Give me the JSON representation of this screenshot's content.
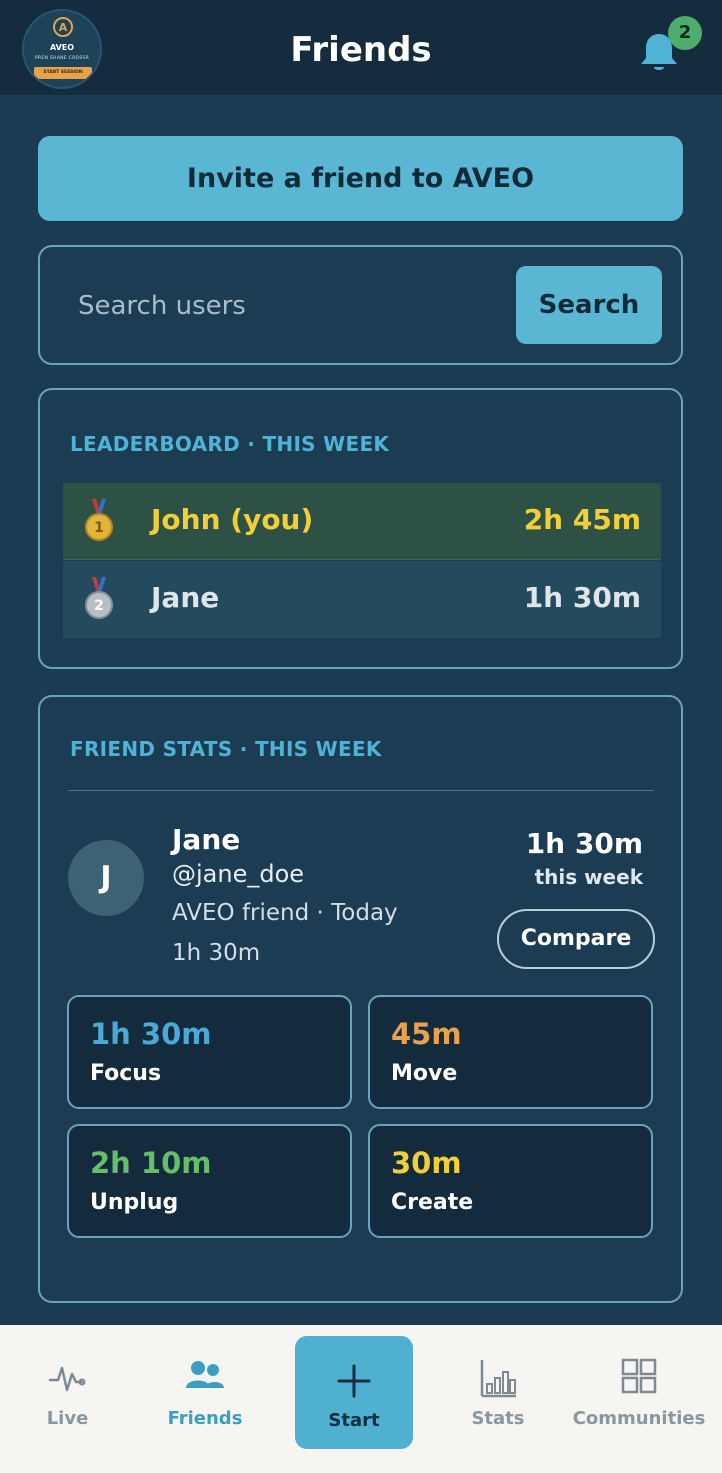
{
  "header": {
    "title": "Friends",
    "notification_count": "2",
    "logo": {
      "letter": "A",
      "name": "AVEO",
      "tagline": "PREN SHANE CROSSR",
      "band": "START SESSION"
    }
  },
  "invite": {
    "label": "Invite a friend to AVEO"
  },
  "search": {
    "placeholder": "Search users",
    "value": "",
    "button_label": "Search"
  },
  "leaderboard": {
    "heading": "LEADERBOARD · THIS WEEK",
    "rows": [
      {
        "rank": "1",
        "name": "John (you)",
        "time": "2h 45m",
        "medal": "gold-medal-icon"
      },
      {
        "rank": "2",
        "name": "Jane",
        "time": "1h 30m",
        "medal": "silver-medal-icon"
      }
    ]
  },
  "friend_stats": {
    "heading": "FRIEND STATS · THIS WEEK",
    "friend": {
      "initial": "J",
      "name": "Jane",
      "handle": "@jane_doe",
      "meta": "AVEO friend · Today",
      "total": "1h 30m",
      "week_time": "1h 30m",
      "week_label": "this week",
      "compare_label": "Compare"
    },
    "tiles": [
      {
        "value": "1h 30m",
        "label": "Focus",
        "color": "#4aa9d6"
      },
      {
        "value": "45m",
        "label": "Move",
        "color": "#e7a24e"
      },
      {
        "value": "2h 10m",
        "label": "Unplug",
        "color": "#66bd6a"
      },
      {
        "value": "30m",
        "label": "Create",
        "color": "#f2cf3a"
      }
    ]
  },
  "nav": {
    "items": [
      {
        "label": "Live",
        "icon": "pulse-icon"
      },
      {
        "label": "Friends",
        "icon": "friends-icon",
        "active": true
      },
      {
        "label": "Start",
        "icon": "plus-icon"
      },
      {
        "label": "Stats",
        "icon": "bar-chart-icon"
      },
      {
        "label": "Communities",
        "icon": "grid-icon"
      }
    ]
  },
  "colors": {
    "background": "#1b3b52",
    "accent": "#5ab7d3",
    "leader_first": "#f2cf3a"
  }
}
